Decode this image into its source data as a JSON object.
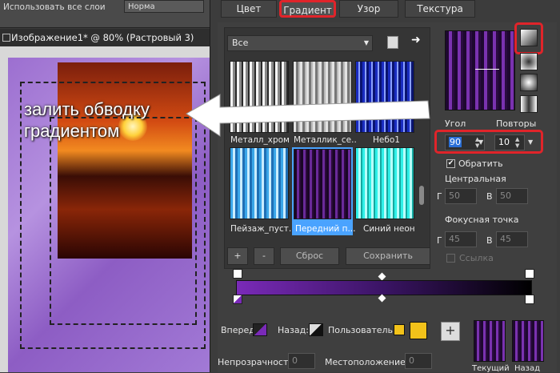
{
  "topbar": {
    "left_text": "Использовать все слои",
    "blend_mode": "Норма"
  },
  "image_window": {
    "title": "Изображение1* @  80% (Растровый 3)"
  },
  "annotation": {
    "line1": "залить обводку",
    "line2": "градиентом"
  },
  "dialog": {
    "tabs": [
      {
        "label": "Цвет",
        "active": false
      },
      {
        "label": "Градиент",
        "active": true
      },
      {
        "label": "Узор",
        "active": false
      },
      {
        "label": "Текстура",
        "active": false
      }
    ],
    "filter": {
      "value": "Все"
    },
    "swatches": [
      {
        "label": "Металл_хром",
        "selected": false
      },
      {
        "label": "Металлик_се...",
        "selected": false
      },
      {
        "label": "Небо1",
        "selected": false
      },
      {
        "label": "Пейзаж_пуст...",
        "selected": false
      },
      {
        "label": "Передний п...",
        "selected": true
      },
      {
        "label": "Синий неон",
        "selected": false
      }
    ],
    "buttons": {
      "add": "+",
      "remove": "-",
      "reset": "Сброс",
      "save": "Сохранить"
    },
    "angle": {
      "label": "Угол",
      "value": "90"
    },
    "repeats": {
      "label": "Повторы",
      "value": "10"
    },
    "invert": {
      "label": "Обратить",
      "checked": true
    },
    "center": {
      "label": "Центральная",
      "h_label": "Г",
      "h_value": "50",
      "v_label": "В",
      "v_value": "50"
    },
    "focus": {
      "label": "Фокусная точка",
      "h_label": "Г",
      "h_value": "45",
      "v_label": "В",
      "v_value": "45"
    },
    "link": {
      "label": "Ссылка"
    },
    "bottom": {
      "forward_label": "Вперед:",
      "back_label": "Назад:",
      "custom_label": "Пользователь:",
      "opacity_label": "Непрозрачность:",
      "opacity_value": "0",
      "location_label": "Местоположение:",
      "location_value": "0",
      "current_label": "Текущий",
      "back_preview_label": "Назад"
    }
  },
  "colors": {
    "accent_red": "#e0242a",
    "purple": "#6a2a9a",
    "swatch_selected": "#4aa3ff",
    "custom_yellow": "#f2c21a"
  }
}
